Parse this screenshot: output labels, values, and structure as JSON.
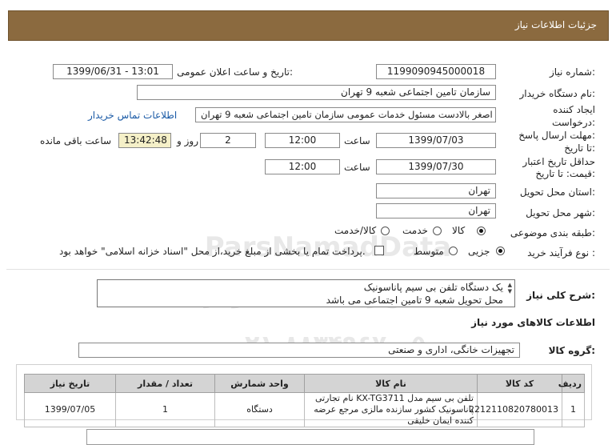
{
  "header": {
    "title": "جزئیات اطلاعات نیاز"
  },
  "fields": {
    "need_number_label": "شماره نیاز:",
    "need_number": "1199090945000018",
    "announce_label": "تاریخ و ساعت اعلان عمومی:",
    "announce_value": "1399/06/31 - 13:01",
    "buyer_org_label": "نام دستگاه خریدار:",
    "buyer_org": "سازمان تامین اجتماعی شعبه 9 تهران",
    "creator_label_1": "ایجاد کننده",
    "creator_label_2": "درخواست:",
    "creator": "اصغر بالادست مسئول خدمات عمومی سازمان تامین اجتماعی شعبه 9 تهران",
    "contact_link": "اطلاعات تماس خریدار",
    "reply_label_1": "مهلت ارسال پاسخ:",
    "reply_label_2": "تا تاریخ:",
    "reply_date": "1399/07/03",
    "time_word": "ساعت",
    "reply_time": "12:00",
    "days_value": "2",
    "days_word": "روز و",
    "remaining_time": "13:42:48",
    "remaining_label": "ساعت باقی مانده",
    "validity_label_1": "حداقل تاریخ اعتبار",
    "validity_label_2": "قیمت: تا تاریخ:",
    "validity_date": "1399/07/30",
    "validity_time": "12:00",
    "province_label": "استان محل تحویل:",
    "province": "تهران",
    "city_label": "شهر محل تحویل:",
    "city": "تهران",
    "category_label": "طبقه بندی موضوعی:",
    "category_options": [
      "کالا",
      "خدمت",
      "کالا/خدمت"
    ],
    "purchase_type_label": "نوع فرآیند خرید :",
    "purchase_options": [
      "جزیی",
      "متوسط"
    ],
    "payment_note": "پرداخت تمام یا بخشی از مبلغ خرید،از محل \"اسناد خزانه اسلامی\" خواهد بود."
  },
  "description": {
    "label": "شرح کلی نیاز:",
    "line1": "یک دستگاه تلفن بی سیم پاناسونیک",
    "line2": "محل تحویل شعبه 9 تامین اجتماعی می باشد"
  },
  "goods_section": {
    "title": "اطلاعات کالاهای مورد نیاز",
    "group_label": "گروه کالا:",
    "group_value": "تجهیزات خانگی، اداری و صنعتی"
  },
  "table": {
    "headers": [
      "ردیف",
      "کد کالا",
      "نام کالا",
      "واحد شمارش",
      "تعداد / مقدار",
      "تاریخ نیاز"
    ],
    "rows": [
      {
        "row": "1",
        "code": "2212110820780013",
        "name": "تلفن بی سیم مدل KX-TG3711 نام تجارتی پاناسونیک کشور سازنده مالزی مرجع عرضه کننده ایمان خلیقی",
        "unit": "دستگاه",
        "qty": "1",
        "date": "1399/07/05"
      }
    ]
  },
  "watermark": {
    "line1": "ParsNamadData",
    "line2": "پایگاه اطلاع رسانی مناقصه و مزایده",
    "line3": "۰۲۱-۸۸۳۴۹۶۷۰-۵"
  },
  "colors": {
    "header_bg": "#8b6a3f",
    "link": "#1a5aa6",
    "remaining_bg": "#f5f0c8",
    "table_header_bg": "#d4d4d4"
  }
}
